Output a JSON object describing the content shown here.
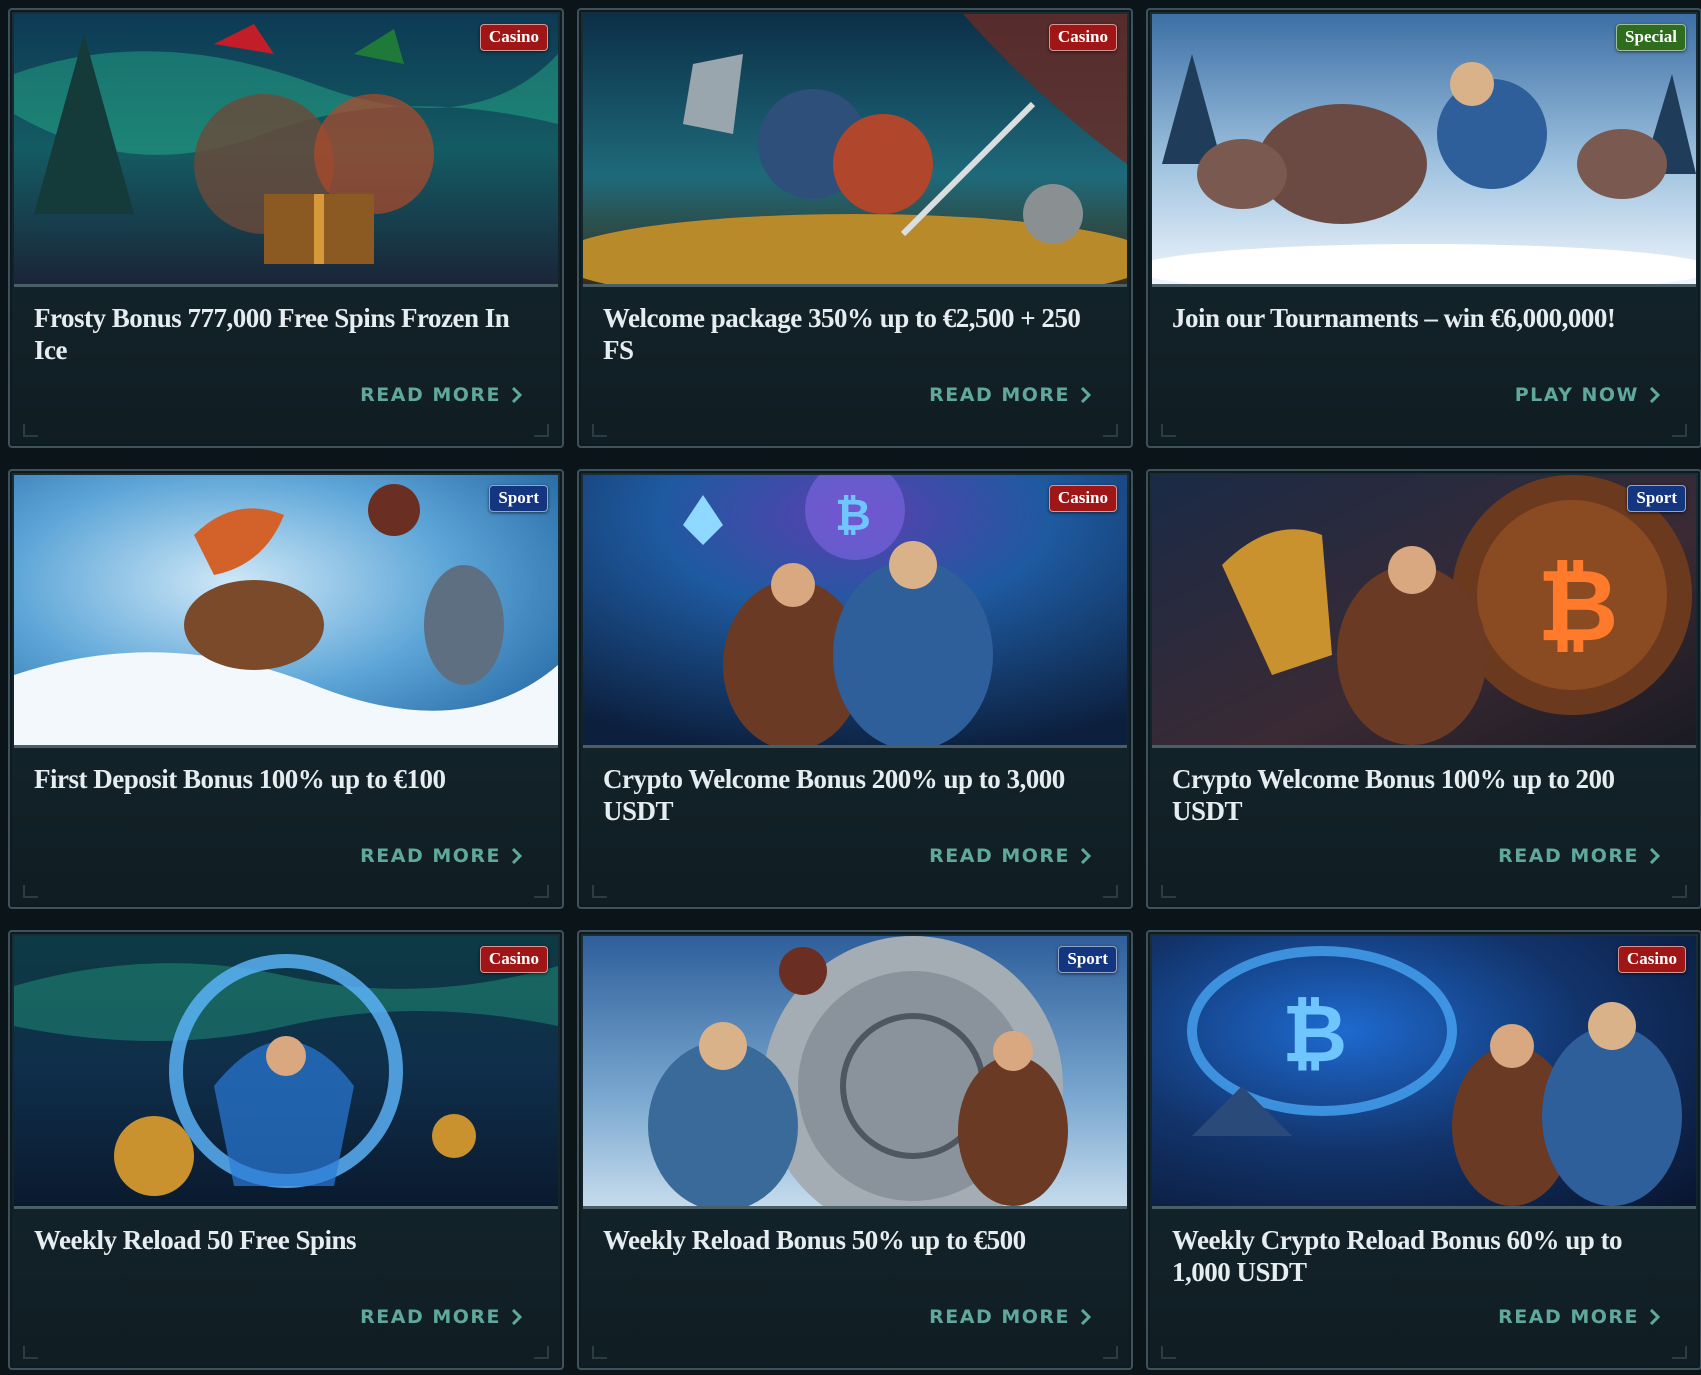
{
  "promos": [
    {
      "title": "Frosty Bonus 777,000 Free Spins Frozen In Ice",
      "badge": "Casino",
      "badge_type": "casino",
      "cta": "READ MORE",
      "art": "gift-vikings-christmas",
      "icon": "chevron-right-icon"
    },
    {
      "title": "Welcome package 350% up to €2,500 + 250 FS",
      "badge": "Casino",
      "badge_type": "casino",
      "cta": "READ MORE",
      "art": "axe-sword-vikings-gold",
      "icon": "chevron-right-icon"
    },
    {
      "title": "Join our Tournaments – win €6,000,000!",
      "badge": "Special",
      "badge_type": "special",
      "cta": "PLAY NOW",
      "art": "viking-boar-chase",
      "icon": "chevron-right-icon"
    },
    {
      "title": "First Deposit Bonus 100% up to €100",
      "badge": "Sport",
      "badge_type": "sport",
      "cta": "READ MORE",
      "art": "viking-ball-snow",
      "icon": "chevron-right-icon"
    },
    {
      "title": "Crypto Welcome Bonus 200% up to 3,000 USDT",
      "badge": "Casino",
      "badge_type": "casino",
      "cta": "READ MORE",
      "art": "vikings-crypto-portal",
      "icon": "chevron-right-icon"
    },
    {
      "title": "Crypto Welcome Bonus 100% up to 200 USDT",
      "badge": "Sport",
      "badge_type": "sport",
      "cta": "READ MORE",
      "art": "horn-bitcoin-shield",
      "icon": "chevron-right-icon"
    },
    {
      "title": "Weekly Reload 50 Free Spins",
      "badge": "Casino",
      "badge_type": "casino",
      "cta": "READ MORE",
      "art": "reload-rune-circle",
      "icon": "chevron-right-icon"
    },
    {
      "title": "Weekly Reload Bonus 50% up to €500",
      "badge": "Sport",
      "badge_type": "sport",
      "cta": "READ MORE",
      "art": "vikings-rune-wheel-ball",
      "icon": "chevron-right-icon"
    },
    {
      "title": "Weekly Crypto Reload Bonus 60% up to 1,000 USDT",
      "badge": "Casino",
      "badge_type": "casino",
      "cta": "READ MORE",
      "art": "bitcoin-portal-vikings",
      "icon": "chevron-right-icon"
    }
  ],
  "colors": {
    "background": "#0b1519",
    "cta": "#5fa89b",
    "casino_badge": "#a01616",
    "sport_badge": "#14357f",
    "special_badge": "#2f6d1e"
  }
}
